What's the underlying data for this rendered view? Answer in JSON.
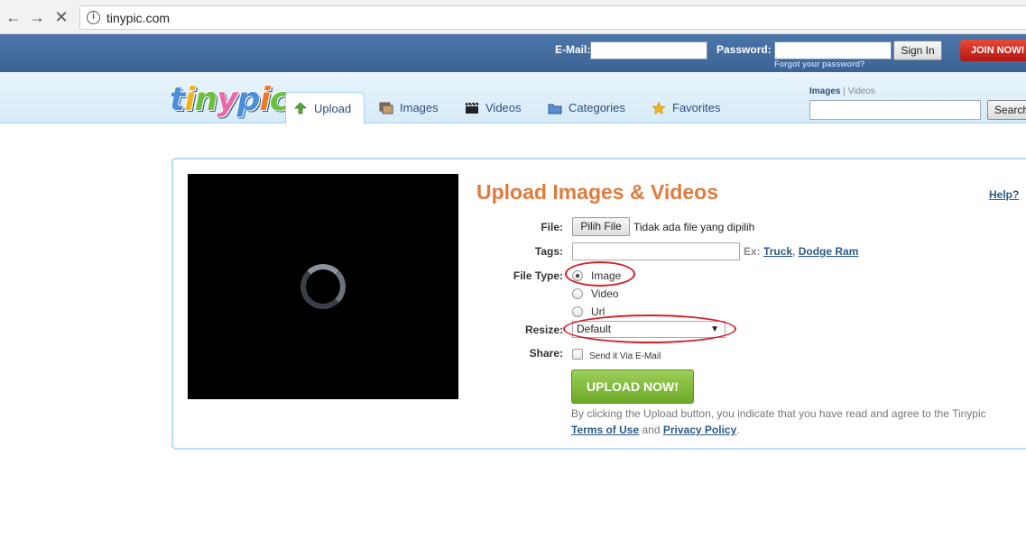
{
  "browser": {
    "url": "tinypic.com"
  },
  "login": {
    "email_label": "E-Mail:",
    "password_label": "Password:",
    "signin_label": "Sign In",
    "forgot_label": "Forgot your password?",
    "join_label": "JOIN NOW!"
  },
  "header": {
    "logo": "tinypic",
    "tabs": [
      {
        "label": "Upload",
        "icon": "upload-arrow-icon",
        "active": true
      },
      {
        "label": "Images",
        "icon": "images-icon"
      },
      {
        "label": "Videos",
        "icon": "film-clapper-icon"
      },
      {
        "label": "Categories",
        "icon": "folder-icon"
      },
      {
        "label": "Favorites",
        "icon": "star-icon"
      }
    ],
    "search_scope": {
      "active": "Images",
      "separator": "|",
      "other": "Videos"
    },
    "search_button": "Search"
  },
  "upload": {
    "title": "Upload Images & Videos",
    "help": "Help?",
    "file_label": "File:",
    "choose_button": "Pilih File",
    "no_file_text": "Tidak ada file yang dipilih",
    "tags_label": "Tags:",
    "tags_example_prefix": "Ex:",
    "tags_examples": [
      "Truck",
      "Dodge Ram"
    ],
    "filetype_label": "File Type:",
    "filetype_options": [
      "Image",
      "Video",
      "Url"
    ],
    "filetype_selected": "Image",
    "resize_label": "Resize:",
    "resize_value": "Default",
    "share_label": "Share:",
    "share_checkbox": "Send it Via E-Mail",
    "upload_button": "UPLOAD NOW!",
    "terms_text": "By clicking the Upload button, you indicate that you have read and agree to the Tinypic",
    "terms_link": "Terms of Use",
    "terms_and": "and",
    "privacy_link": "Privacy Policy",
    "terms_end": "."
  },
  "colors": {
    "title": "#e07b3c",
    "login_strip": "#4a74a8",
    "upload_button": "#8bc34a",
    "annotation_ellipse": "#d2202b"
  }
}
